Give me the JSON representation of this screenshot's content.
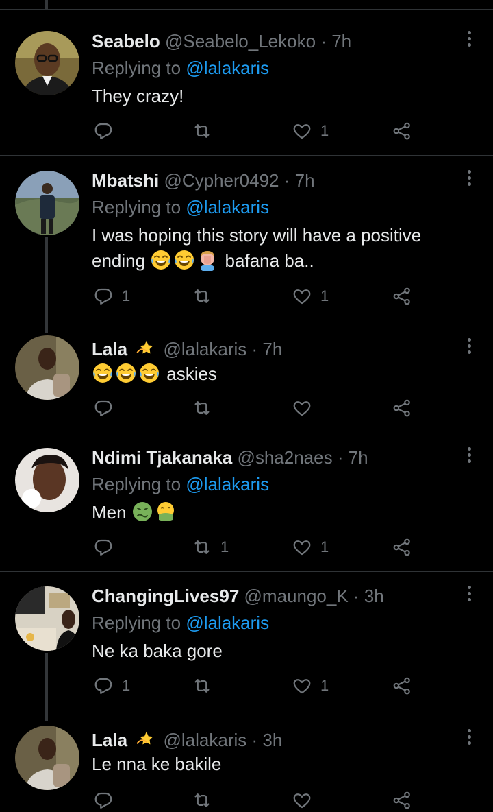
{
  "tweets": [
    {
      "name": "Seabelo",
      "handle": "@Seabelo_Lekoko",
      "time": "· 7h",
      "replying_label": "Replying to",
      "replying_to": "@lalakaris",
      "text": "They crazy!",
      "replies": "",
      "retweets": "",
      "likes": "1"
    },
    {
      "name": "Mbatshi",
      "handle": "@Cypher0492",
      "time": "· 7h",
      "replying_label": "Replying to",
      "replying_to": "@lalakaris",
      "text_line1": "I was hoping this story will have a positive",
      "text_line2_before": "ending",
      "text_line2_after": "bafana ba..",
      "replies": "1",
      "retweets": "",
      "likes": "1"
    },
    {
      "name": "Lala",
      "handle": "@lalakaris",
      "time": "· 7h",
      "text_after_emoji": "askies",
      "replies": "",
      "retweets": "",
      "likes": ""
    },
    {
      "name": "Ndimi Tjakanaka",
      "handle": "@sha2naes",
      "time": "· 7h",
      "replying_label": "Replying to",
      "replying_to": "@lalakaris",
      "text": "Men",
      "replies": "",
      "retweets": "1",
      "likes": "1"
    },
    {
      "name": "ChangingLives97",
      "handle": "@maungo_K",
      "time": "· 3h",
      "replying_label": "Replying to",
      "replying_to": "@lalakaris",
      "text": "Ne ka baka gore",
      "replies": "1",
      "retweets": "",
      "likes": "1"
    },
    {
      "name": "Lala",
      "handle": "@lalakaris",
      "time": "· 3h",
      "text": "Le nna ke bakile",
      "replies": "",
      "retweets": "",
      "likes": ""
    }
  ],
  "colors": {
    "background": "#000000",
    "text": "#e7e9ea",
    "muted": "#71767b",
    "link": "#1d9bf0",
    "divider": "#2f3336"
  }
}
